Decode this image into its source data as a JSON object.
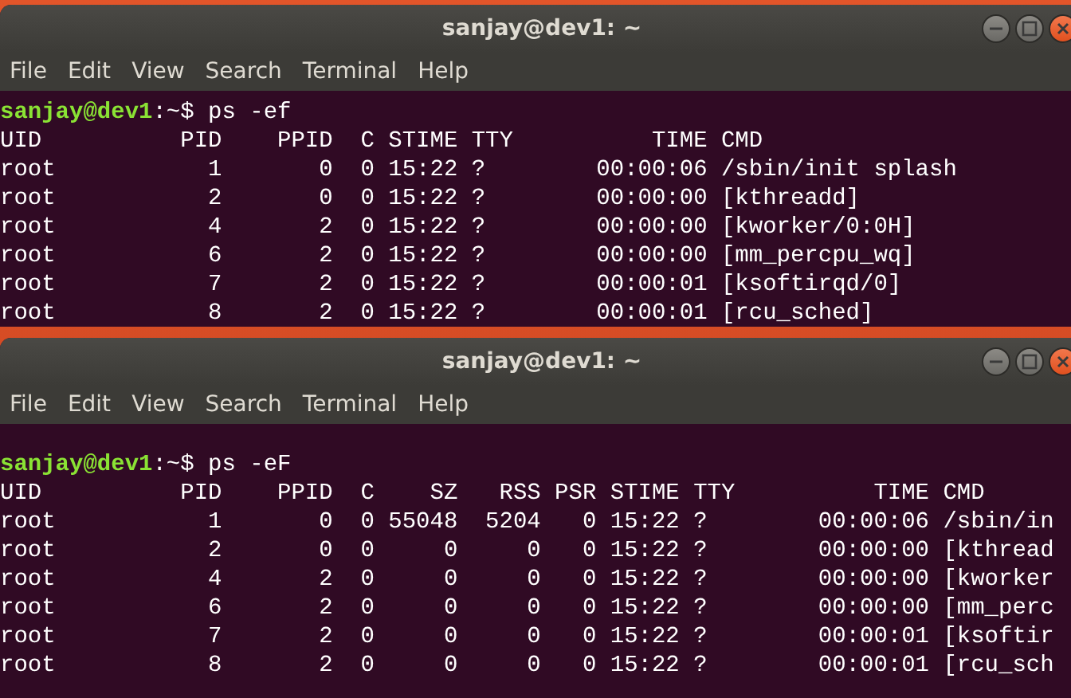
{
  "windows": [
    {
      "title": "sanjay@dev1: ~",
      "menu": [
        "File",
        "Edit",
        "View",
        "Search",
        "Terminal",
        "Help"
      ],
      "prompt_host": "sanjay@dev1",
      "prompt_rest": ":~$ ps -ef",
      "header": "UID          PID    PPID  C STIME TTY          TIME CMD",
      "rows": [
        "root           1       0  0 15:22 ?        00:00:06 /sbin/init splash",
        "root           2       0  0 15:22 ?        00:00:00 [kthreadd]",
        "root           4       2  0 15:22 ?        00:00:00 [kworker/0:0H]",
        "root           6       2  0 15:22 ?        00:00:00 [mm_percpu_wq]",
        "root           7       2  0 15:22 ?        00:00:01 [ksoftirqd/0]",
        "root           8       2  0 15:22 ?        00:00:01 [rcu_sched]"
      ]
    },
    {
      "title": "sanjay@dev1: ~",
      "menu": [
        "File",
        "Edit",
        "View",
        "Search",
        "Terminal",
        "Help"
      ],
      "prompt_host": "sanjay@dev1",
      "prompt_rest": ":~$ ps -eF",
      "header": "UID          PID    PPID  C    SZ   RSS PSR STIME TTY          TIME CMD",
      "rows": [
        "root           1       0  0 55048  5204   0 15:22 ?        00:00:06 /sbin/in",
        "root           2       0  0     0     0   0 15:22 ?        00:00:00 [kthread",
        "root           4       2  0     0     0   0 15:22 ?        00:00:00 [kworker",
        "root           6       2  0     0     0   0 15:22 ?        00:00:00 [mm_perc",
        "root           7       2  0     0     0   0 15:22 ?        00:00:01 [ksoftir",
        "root           8       2  0     0     0   0 15:22 ?        00:00:01 [rcu_sch"
      ]
    }
  ]
}
